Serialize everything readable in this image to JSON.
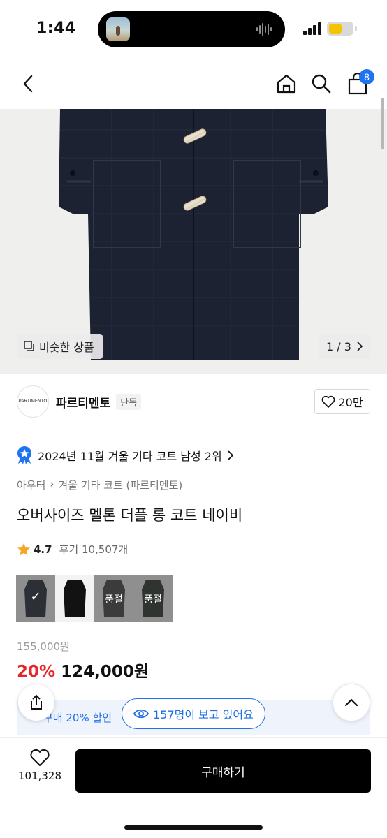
{
  "status_bar": {
    "time": "1:44"
  },
  "nav": {
    "cart_count": "8"
  },
  "hero": {
    "similar_label": "비슷한 상품",
    "pager": "1 / 3"
  },
  "brand": {
    "logo_text": "PARTIMENTO",
    "name": "파르티멘토",
    "tag": "단독",
    "like_count": "20만"
  },
  "rank": {
    "text": "2024년 11월 겨울 기타 코트 남성 2위"
  },
  "category": {
    "level1": "아우터",
    "level2": "겨울 기타 코트 (파르티멘토)"
  },
  "product": {
    "title": "오버사이즈 멜톤 더플 롱 코트 네이비"
  },
  "rating": {
    "score": "4.7",
    "review_label": "후기 10,507개"
  },
  "swatches": [
    {
      "label": "",
      "selected": true
    },
    {
      "label": ""
    },
    {
      "label": "품절"
    },
    {
      "label": "품절"
    }
  ],
  "price": {
    "original": "155,000원",
    "discount": "20%",
    "final": "124,000원"
  },
  "coupon": {
    "text": "구매 20% 할인"
  },
  "viewing": {
    "text": "157명이 보고 있어요"
  },
  "bottom": {
    "like_count": "101,328",
    "buy_label": "구매하기"
  },
  "colors": {
    "accent_blue": "#1f73f0",
    "discount_red": "#e5252b",
    "buy_button": "#000000"
  }
}
